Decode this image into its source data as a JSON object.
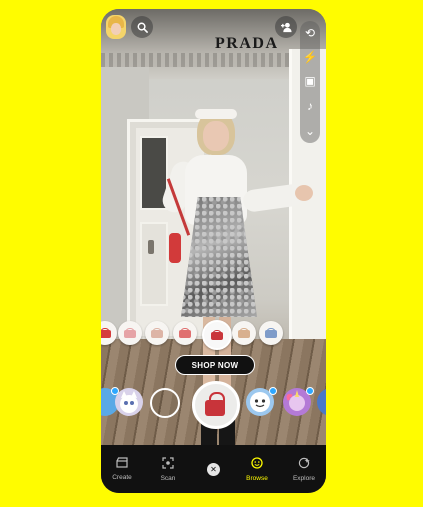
{
  "brand": {
    "name": "PRADA"
  },
  "top_bar": {
    "avatar": "bitmoji-avatar",
    "search_icon": "search-icon",
    "add_friend_icon": "add-friend-icon"
  },
  "side_tools": [
    {
      "icon": "flip-camera-icon",
      "glyph": "⟲"
    },
    {
      "icon": "flash-off-icon",
      "glyph": "⚡"
    },
    {
      "icon": "film-icon",
      "glyph": "▣"
    },
    {
      "icon": "music-icon",
      "glyph": "♪"
    },
    {
      "icon": "chevron-down-icon",
      "glyph": "⌄"
    }
  ],
  "products": [
    {
      "color": "#d53c3c",
      "name": "bag-red"
    },
    {
      "color": "#e6a3a6",
      "name": "bag-pink"
    },
    {
      "color": "#ddb4a6",
      "name": "bag-blush"
    },
    {
      "color": "#e07070",
      "name": "bag-coral"
    },
    {
      "color": "#c9363c",
      "name": "bag-red-selected",
      "selected": true
    },
    {
      "color": "#d8b08f",
      "name": "bag-tan"
    },
    {
      "color": "#7f9cc9",
      "name": "bag-blue"
    }
  ],
  "shop_now": {
    "label": "SHOP NOW"
  },
  "lenses": [
    {
      "name": "lens-1",
      "color": "#5aa9e6"
    },
    {
      "name": "lens-cat",
      "color": "#d9d2ea"
    },
    {
      "name": "lens-empty"
    },
    {
      "name": "lens-prada-bag",
      "active": true
    },
    {
      "name": "lens-face",
      "color": "#9cc8ef"
    },
    {
      "name": "lens-unicorn",
      "color": "#b47ad6"
    },
    {
      "name": "lens-blue",
      "color": "#4a78c8"
    }
  ],
  "bottom_nav": [
    {
      "label": "Create",
      "icon": "clapperboard-icon",
      "glyph": "🎬"
    },
    {
      "label": "Scan",
      "icon": "scan-icon",
      "glyph": "⊡"
    },
    {
      "label": "Browse",
      "icon": "smiley-icon",
      "glyph": "☺",
      "active": true
    },
    {
      "label": "Explore",
      "icon": "explore-icon",
      "glyph": "✦"
    }
  ],
  "colors": {
    "background": "#FFFC00",
    "active_nav": "#FFFC00",
    "shop_now_bg": "#111111"
  }
}
